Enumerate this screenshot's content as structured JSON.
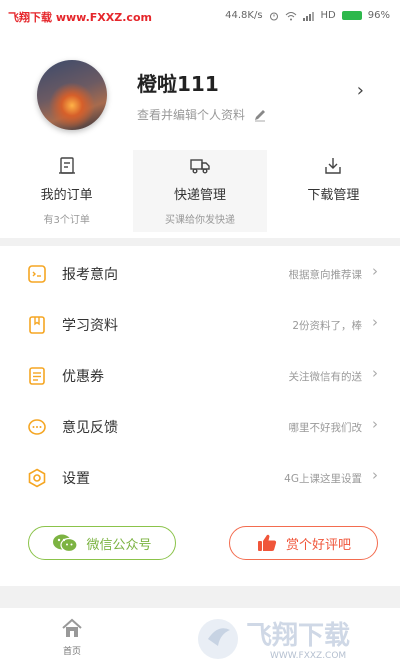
{
  "status_bar": {
    "watermark": "飞翔下载 www.FXXZ.com",
    "speed": "44.8K/s",
    "network": "HD",
    "battery": "96%"
  },
  "profile": {
    "name": "橙啦111",
    "edit_hint": "查看并编辑个人资料"
  },
  "quick": [
    {
      "label": "我的订单",
      "sub": "有3个订单",
      "icon": "receipt-icon"
    },
    {
      "label": "快递管理",
      "sub": "买课给你发快递",
      "icon": "truck-icon"
    },
    {
      "label": "下载管理",
      "sub": "",
      "icon": "download-icon"
    }
  ],
  "menu": [
    {
      "label": "报考意向",
      "hint": "根据意向推荐课",
      "icon": "target-icon"
    },
    {
      "label": "学习资料",
      "hint": "2份资料了，棒",
      "icon": "bookmark-icon"
    },
    {
      "label": "优惠券",
      "hint": "关注微信有的送",
      "icon": "coupon-icon"
    },
    {
      "label": "意见反馈",
      "hint": "哪里不好我们改",
      "icon": "chat-icon"
    },
    {
      "label": "设置",
      "hint": "4G上课这里设置",
      "icon": "settings-icon"
    }
  ],
  "buttons": {
    "wechat": "微信公众号",
    "review": "赏个好评吧"
  },
  "tabbar": {
    "home": "首页",
    "watermark": "飞翔下载",
    "watermark_url": "WWW.FXXZ.COM"
  },
  "colors": {
    "accent_orange": "#f5a623",
    "wechat_green": "#7cb342",
    "review_red": "#f0553a"
  }
}
